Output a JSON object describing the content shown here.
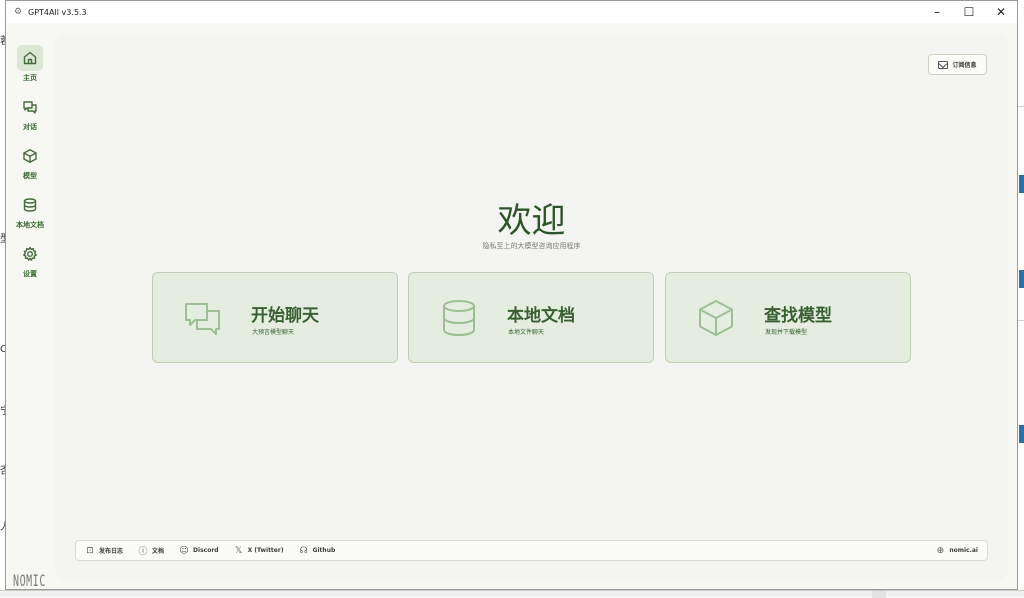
{
  "window": {
    "title": "GPT4All v3.5.3"
  },
  "sidebar": {
    "items": [
      {
        "label": "主页",
        "icon": "home-icon",
        "active": true
      },
      {
        "label": "对话",
        "icon": "chat-icon",
        "active": false
      },
      {
        "label": "模型",
        "icon": "cube-icon",
        "active": false
      },
      {
        "label": "本地文档",
        "icon": "database-icon",
        "active": false
      },
      {
        "label": "设置",
        "icon": "gear-icon",
        "active": false
      }
    ],
    "logo": "NOMIC"
  },
  "header": {
    "subscribe_label": "订阅信息"
  },
  "hero": {
    "title": "欢迎",
    "subtitle": "隐私至上的大模型咨询应用程序"
  },
  "cards": [
    {
      "title": "开始聊天",
      "subtitle": "大预言模型聊天",
      "icon": "chat-bubbles-icon"
    },
    {
      "title": "本地文档",
      "subtitle": "本地文件聊天",
      "icon": "database-icon"
    },
    {
      "title": "查找模型",
      "subtitle": "发现并下载模型",
      "icon": "cube-icon"
    }
  ],
  "footer": {
    "links": [
      {
        "label": "发布日志",
        "icon": "changelog-icon"
      },
      {
        "label": "文档",
        "icon": "info-icon"
      },
      {
        "label": "Discord",
        "icon": "discord-icon"
      },
      {
        "label": "X (Twitter)",
        "icon": "x-icon"
      },
      {
        "label": "Github",
        "icon": "github-icon"
      }
    ],
    "site": {
      "label": "nomic.ai",
      "icon": "globe-icon"
    }
  },
  "background_fragments": [
    "蓉",
    "型",
    "Oc",
    "宁",
    "否",
    "人"
  ],
  "colors": {
    "accent": "#3a5f33",
    "card_bg": "#e4eddf",
    "card_border": "#bcd1b3",
    "nav_active_bg": "#dde7d6"
  }
}
